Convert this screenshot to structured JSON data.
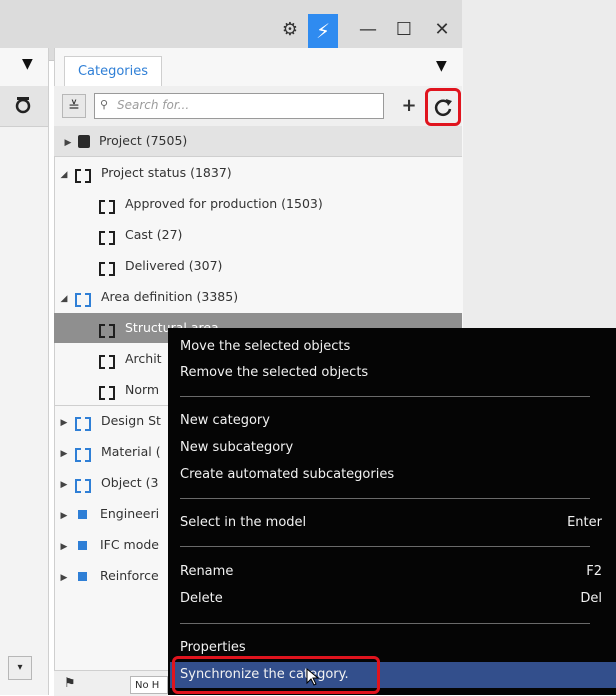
{
  "window": {
    "controls": {
      "settings": "⚙",
      "bolt": "⚡",
      "minimize": "—",
      "maximize": "☐",
      "close": "✕"
    }
  },
  "left_panel": {
    "dropdown_arrow": "▼",
    "icon": "refresh-icon"
  },
  "categories_panel": {
    "tab_label": "Categories",
    "dropdown_arrow": "▼",
    "search": {
      "placeholder": "Search for..."
    },
    "add_label": "+",
    "collapse_label": "≚",
    "refresh_icon": "refresh-icon"
  },
  "tree": [
    {
      "label": "Project (7505)",
      "icon": "project-icon",
      "expander": "▶"
    },
    {
      "label": "Project status (1837)",
      "icon": "category-icon",
      "expander": "◢"
    },
    {
      "label": "Approved for production (1503)",
      "icon": "category-icon"
    },
    {
      "label": "Cast (27)",
      "icon": "category-icon"
    },
    {
      "label": "Delivered (307)",
      "icon": "category-icon"
    },
    {
      "label": "Area definition (3385)",
      "icon": "category-icon-blue",
      "expander": "◢"
    },
    {
      "label": "Structural area",
      "icon": "category-icon",
      "selected": true
    },
    {
      "label": "Archit",
      "icon": "category-icon"
    },
    {
      "label": "Norm",
      "icon": "category-icon"
    },
    {
      "label": "Design St",
      "icon": "category-icon-blue",
      "expander": "▶"
    },
    {
      "label": "Material (",
      "icon": "category-icon-blue",
      "expander": "▶"
    },
    {
      "label": "Object (3",
      "icon": "category-icon-blue",
      "expander": "▶"
    },
    {
      "label": "Engineeri",
      "icon": "square-icon",
      "expander": "▶"
    },
    {
      "label": "IFC mode",
      "icon": "square-icon",
      "expander": "▶"
    },
    {
      "label": "Reinforce",
      "icon": "square-icon",
      "expander": "▶"
    }
  ],
  "context_menu": {
    "items": [
      {
        "label": "Move the selected objects"
      },
      {
        "label": "Remove the selected objects"
      },
      {
        "label": "New category"
      },
      {
        "label": "New subcategory"
      },
      {
        "label": "Create automated subcategories"
      },
      {
        "label": "Select in the model",
        "shortcut": "Enter"
      },
      {
        "label": "Rename",
        "shortcut": "F2"
      },
      {
        "label": "Delete",
        "shortcut": "Del"
      },
      {
        "label": "Properties"
      },
      {
        "label": "Synchronize the category."
      }
    ]
  },
  "bottom_bar": {
    "text": "No H"
  },
  "colors": {
    "accent": "#2f7fd6",
    "highlight_outline": "#e0141e",
    "menu_bg": "#050505",
    "menu_selected": "#334f8c",
    "selected_row": "#8f8f8f"
  }
}
